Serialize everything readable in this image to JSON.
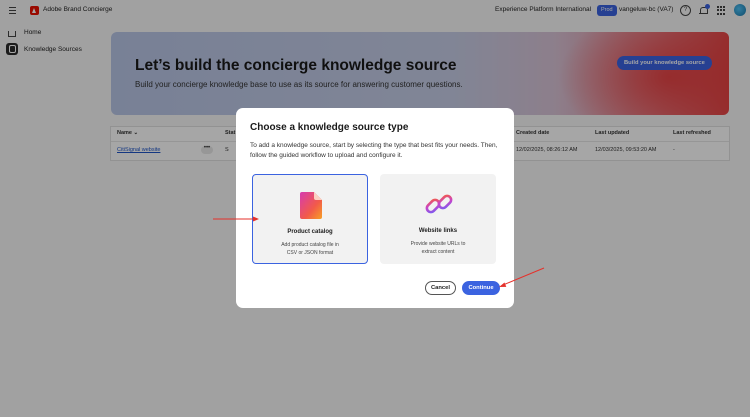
{
  "header": {
    "app_title": "Adobe Brand Concierge",
    "org_name": "Experience Platform International",
    "env_badge": "Prod",
    "sandbox_name": "vangeluw-bc (VA7)",
    "help_glyph": "?"
  },
  "sidebar": {
    "items": [
      {
        "label": "Home",
        "icon": "home-icon"
      },
      {
        "label": "Knowledge Sources",
        "icon": "database-icon"
      }
    ]
  },
  "hero": {
    "title": "Let’s build the concierge knowledge source",
    "subtitle": "Build your concierge knowledge base to use as its source for answering customer questions.",
    "button_label": "Build your knowledge source"
  },
  "table": {
    "columns": [
      "Name",
      "Stat",
      "Created date",
      "Last updated",
      "Last refreshed"
    ],
    "rows": [
      {
        "name": "CitiSignal website",
        "more": "•••",
        "status": "S",
        "created": "12/02/2025, 08:26:12 AM",
        "updated": "12/03/2025, 09:53:20 AM",
        "refreshed": "-"
      }
    ]
  },
  "dialog": {
    "title": "Choose a knowledge source type",
    "description": "To add a knowledge source, start by selecting the type that best fits your needs. Then, follow the guided workflow to upload and configure it.",
    "cards": [
      {
        "title": "Product catalog",
        "desc_line1": "Add product catalog file in",
        "desc_line2": "CSV or JSON format",
        "selected": true
      },
      {
        "title": "Website links",
        "desc_line1": "Provide website URLs to",
        "desc_line2": "extract content",
        "selected": false
      }
    ],
    "cancel_label": "Cancel",
    "continue_label": "Continue"
  },
  "colors": {
    "accent": "#3b63e0",
    "annotation_red": "#e5312b"
  }
}
